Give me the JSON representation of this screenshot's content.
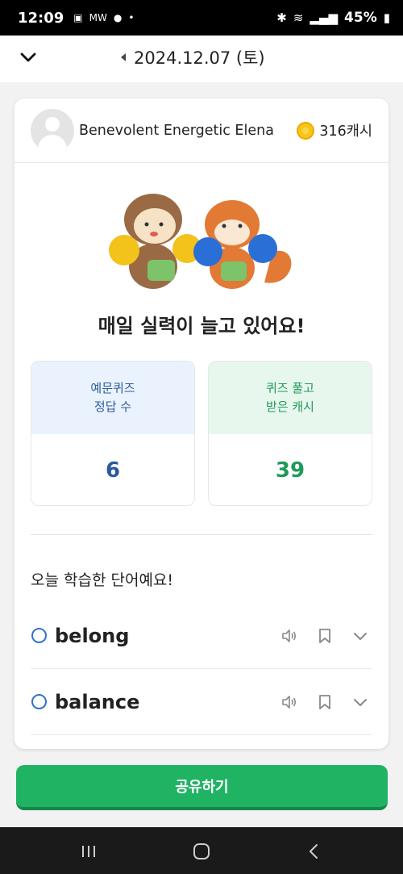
{
  "status_bar": {
    "time": "12:09",
    "battery": "45%"
  },
  "header": {
    "date": "2024.12.07 (토)"
  },
  "user": {
    "name": "Benevolent Energetic Elena",
    "cash": "316캐시"
  },
  "headline": "매일 실력이 늘고 있어요!",
  "stats": [
    {
      "label_line1": "예문퀴즈",
      "label_line2": "정답 수",
      "value": "6",
      "color": "#2a5c9a"
    },
    {
      "label_line1": "퀴즈 풀고",
      "label_line2": "받은 캐시",
      "value": "39",
      "color": "#1f9a59"
    }
  ],
  "words_section": {
    "title": "오늘 학습한 단어예요!",
    "words": [
      {
        "word": "belong"
      },
      {
        "word": "balance"
      }
    ]
  },
  "share_button": "공유하기",
  "colors": {
    "accent": "#20b364",
    "circle": "#2f73c8"
  }
}
